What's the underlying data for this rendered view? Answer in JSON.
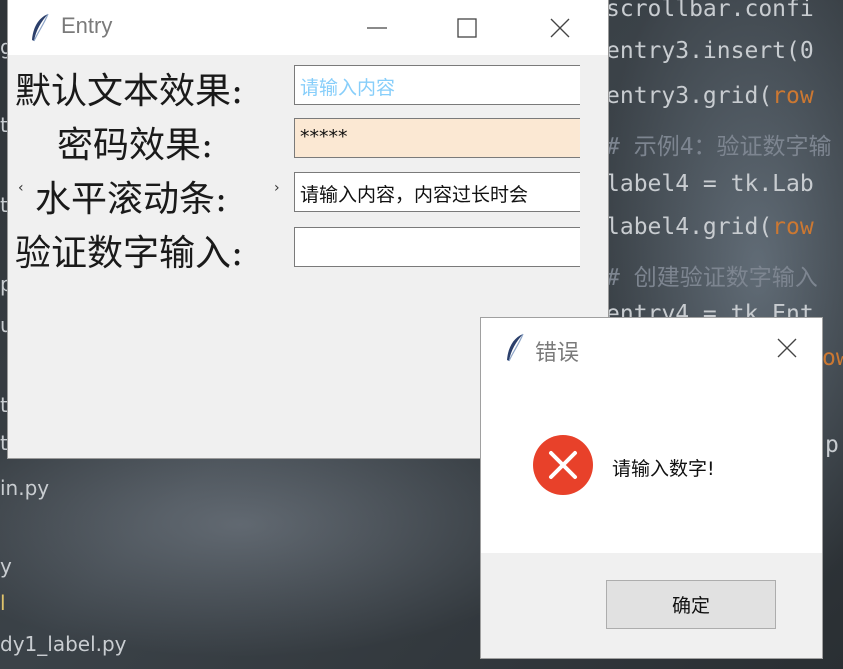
{
  "editor": {
    "code_lines": [
      {
        "text": "scrollbar.confi",
        "type": "code"
      },
      {
        "text": "entry3.insert(0",
        "type": "code"
      },
      {
        "text": "entry3.grid(",
        "type": "code",
        "accent": "row"
      },
      {
        "text": "# 示例4：验证数字输",
        "type": "comment"
      },
      {
        "text": "label4 = tk.Lab",
        "type": "code"
      },
      {
        "text": "label4.grid(",
        "type": "code",
        "accent": "row"
      },
      {
        "text": "# 创建验证数字输入",
        "type": "comment"
      },
      {
        "text": "entry4 = tk.Ent",
        "type": "code"
      },
      {
        "text": "ow",
        "type": "code"
      },
      {
        "text": "p",
        "type": "code"
      }
    ],
    "file_items": [
      "g",
      "t",
      "t",
      "py",
      "u",
      "t",
      "t",
      "t_ _g.py",
      "in.py",
      "",
      "y",
      "l",
      "dy1_label.py"
    ]
  },
  "main_window": {
    "title": "Entry",
    "labels": {
      "default_text": "默认文本效果:",
      "password": "密码效果:",
      "hscroll": "水平滚动条:",
      "validate": "验证数字输入:"
    },
    "entries": {
      "default_text": "请输入内容",
      "password": "*****",
      "hscroll": "请输入内容，内容过长时会",
      "validate": ""
    }
  },
  "dialog": {
    "title": "错误",
    "message": "请输入数字!",
    "ok_label": "确定"
  },
  "colors": {
    "placeholder": "#87cefa",
    "password_bg": "#fbe8d3",
    "error_red": "#e8412a"
  }
}
